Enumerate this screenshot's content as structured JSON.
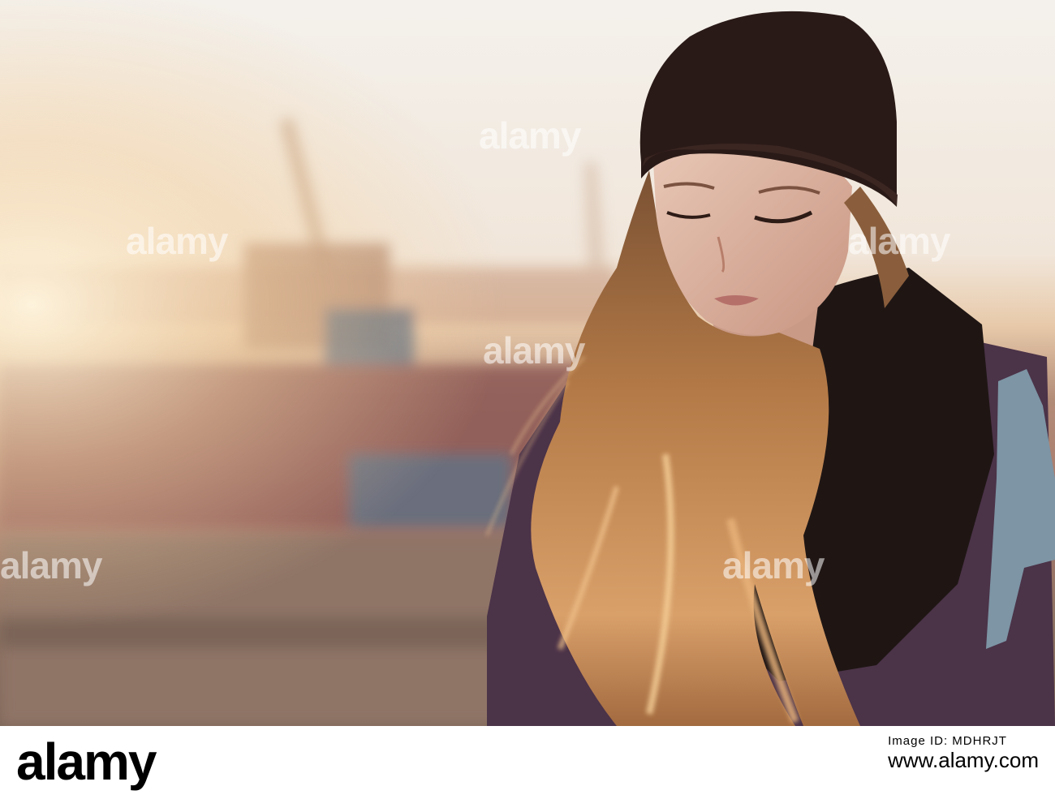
{
  "image": {
    "description_alt": "",
    "colors": {
      "sky": "#f3efe9",
      "haze": "#e8cdb3",
      "hat": "#2a1a17",
      "hair": "#b07a48",
      "hair_light": "#e8b27a",
      "jacket": "#4a3246",
      "scarf": "#1e1513",
      "strap": "#7f97a6",
      "fence": "#8b5b55",
      "ground": "#8a6e5d"
    }
  },
  "watermarks": {
    "text": "alamy",
    "positions_label": "tiled"
  },
  "footer": {
    "logo_text": "alamy",
    "image_id": "Image ID: MDHRJT",
    "site": "www.alamy.com"
  }
}
